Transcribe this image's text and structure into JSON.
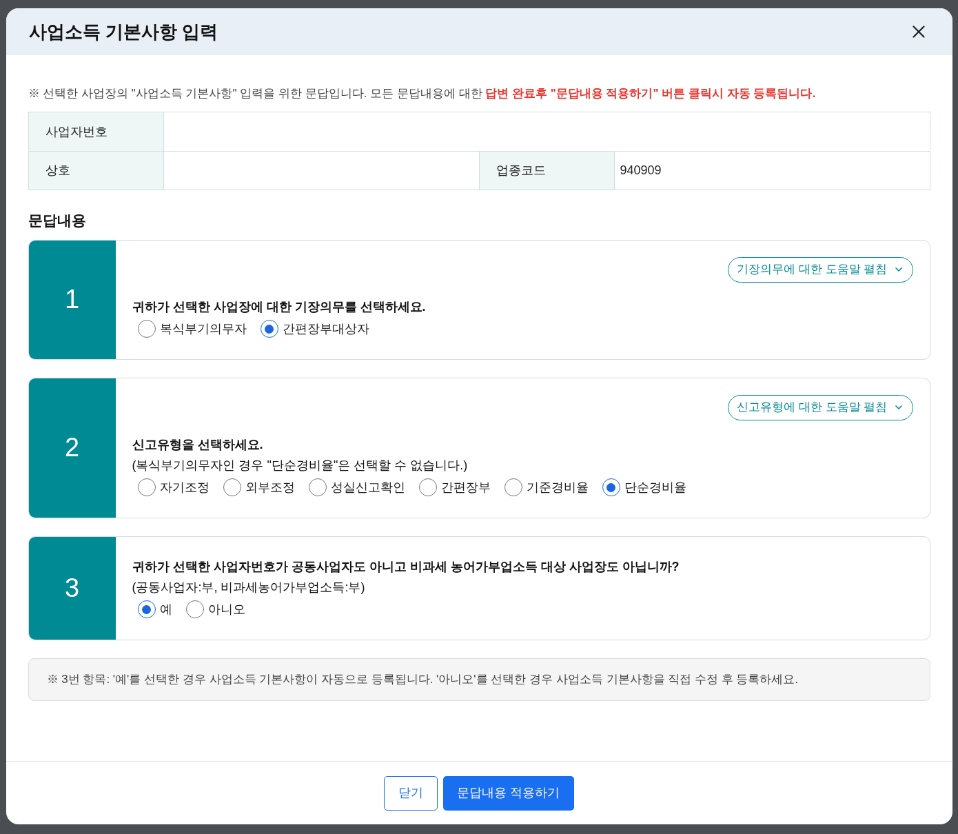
{
  "dialog": {
    "title": "사업소득 기본사항 입력",
    "notice": {
      "text": "※ 선택한 사업장의 \"사업소득 기본사항\" 입력을 위한 문답입니다. 모든 문답내용에 대한",
      "highlight": "답변 완료후 \"문답내용 적용하기\" 버튼 클릭시 자동 등록됩니다."
    },
    "info_table": [
      {
        "cells": [
          {
            "label": "사업자번호"
          }
        ]
      },
      {
        "cells": [
          {
            "label": "상호"
          },
          {
            "label": "업종코드",
            "value": "940909"
          }
        ]
      }
    ],
    "section_title": "문답내용",
    "questions": [
      {
        "number": "1",
        "help_button": "기장의무에 대한 도움말 펼침",
        "lines": [
          "귀하가 선택한 사업장에 대한 기장의무를 선택하세요."
        ],
        "options": [
          {
            "label": "복식부기의무자",
            "selected": false
          },
          {
            "label": "간편장부대상자",
            "selected": true
          }
        ]
      },
      {
        "number": "2",
        "help_button": "신고유형에 대한 도움말 펼침",
        "lines": [
          "신고유형을 선택하세요.",
          "(복식부기의무자인 경우 \"단순경비율\"은 선택할 수 없습니다.)"
        ],
        "options": [
          {
            "label": "자기조정",
            "selected": false
          },
          {
            "label": "외부조정",
            "selected": false
          },
          {
            "label": "성실신고확인",
            "selected": false
          },
          {
            "label": "간편장부",
            "selected": false
          },
          {
            "label": "기준경비율",
            "selected": false
          },
          {
            "label": "단순경비율",
            "selected": true
          }
        ]
      },
      {
        "number": "3",
        "lines": [
          "귀하가 선택한 사업자번호가 공동사업자도 아니고 비과세 농어가부업소득 대상 사업장도 아닙니까?",
          "(공동사업자:부, 비과세농어가부업소득:부)"
        ],
        "options": [
          {
            "label": "예",
            "selected": true
          },
          {
            "label": "아니오",
            "selected": false
          }
        ]
      }
    ],
    "note": "※ 3번 항목: '예'를 선택한 경우 사업소득 기본사항이 자동으로 등록됩니다. '아니오'를 선택한 경우 사업소득 기본사항을 직접 수정 후 등록하세요.",
    "buttons": [
      {
        "label": "닫기",
        "kind": "secondary"
      },
      {
        "label": "문답내용 적용하기",
        "kind": "primary"
      }
    ]
  }
}
